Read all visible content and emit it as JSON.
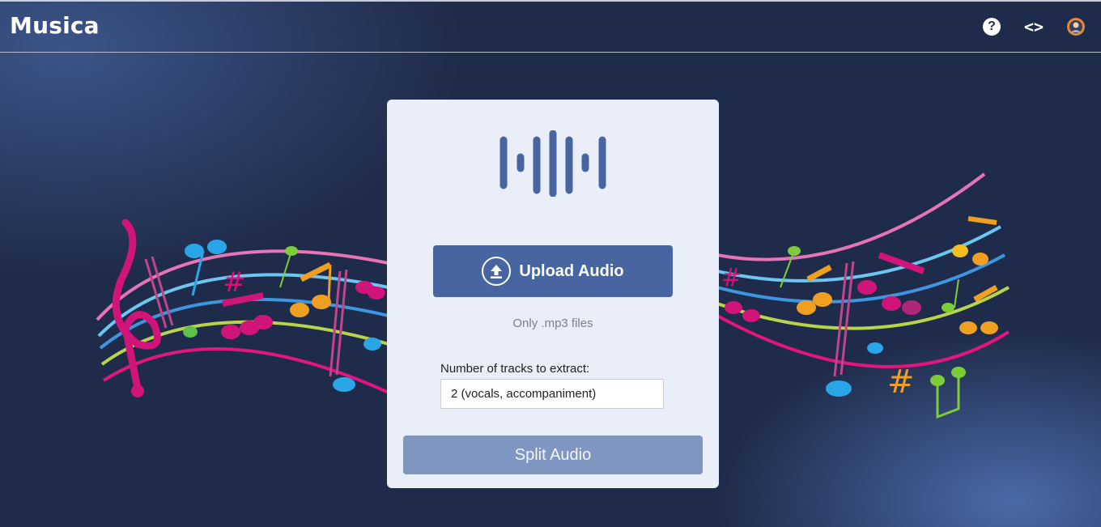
{
  "app": {
    "title": "Musica"
  },
  "nav": {
    "help_icon": "question-circle-icon",
    "code_icon": "code-brackets-icon",
    "profile_icon": "avatar-icon"
  },
  "card": {
    "logo_icon": "audio-waveform-icon",
    "upload_label": "Upload Audio",
    "upload_icon": "upload-arrow-icon",
    "hint": "Only .mp3 files",
    "tracks_label": "Number of tracks to extract:",
    "tracks_value": "2 (vocals, accompaniment)",
    "split_label": "Split Audio"
  },
  "colors": {
    "background": "#1f2b4a",
    "card": "#e9eef9",
    "primary": "#4766a1",
    "disabled": "#7f96c1"
  }
}
